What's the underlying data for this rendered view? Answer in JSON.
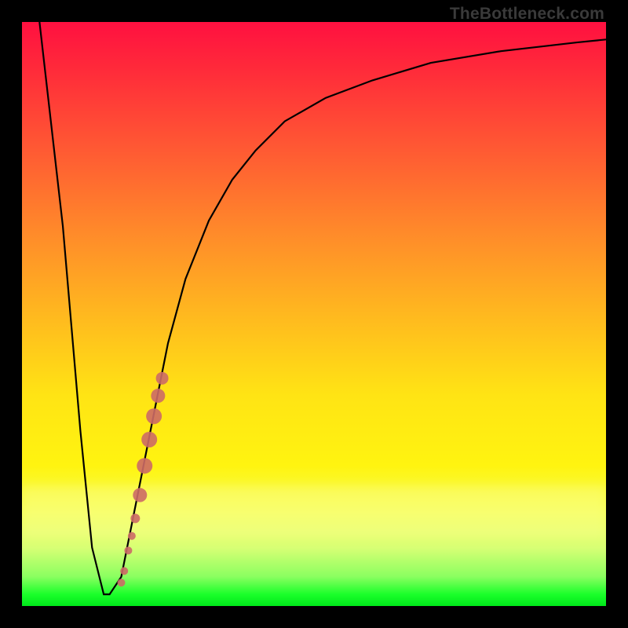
{
  "attribution": "TheBottleneck.com",
  "chart_data": {
    "type": "line",
    "title": "",
    "xlabel": "",
    "ylabel": "",
    "xlim": [
      0,
      100
    ],
    "ylim": [
      0,
      100
    ],
    "grid": false,
    "legend": false,
    "background_gradient": {
      "direction": "vertical",
      "stops": [
        {
          "pos": 0.0,
          "color": "#ff1040"
        },
        {
          "pos": 0.22,
          "color": "#ff5a33"
        },
        {
          "pos": 0.5,
          "color": "#ffb81f"
        },
        {
          "pos": 0.76,
          "color": "#fff410"
        },
        {
          "pos": 0.9,
          "color": "#d8ff75"
        },
        {
          "pos": 1.0,
          "color": "#00e81a"
        }
      ]
    },
    "series": [
      {
        "name": "bottleneck-curve",
        "color": "#000000",
        "x": [
          3,
          7,
          10,
          12,
          14,
          15,
          17,
          19,
          22,
          25,
          28,
          32,
          36,
          40,
          45,
          52,
          60,
          70,
          82,
          95,
          100
        ],
        "y": [
          100,
          65,
          30,
          10,
          2,
          2,
          5,
          15,
          30,
          45,
          56,
          66,
          73,
          78,
          83,
          87,
          90,
          93,
          95,
          96.5,
          97
        ]
      }
    ],
    "scatter": {
      "name": "highlight-points",
      "color": "#cc6a66",
      "points": [
        {
          "x": 17.0,
          "y": 4.0,
          "r": 5
        },
        {
          "x": 17.5,
          "y": 6.0,
          "r": 5
        },
        {
          "x": 18.2,
          "y": 9.5,
          "r": 5
        },
        {
          "x": 18.8,
          "y": 12.0,
          "r": 5
        },
        {
          "x": 19.4,
          "y": 15.0,
          "r": 6
        },
        {
          "x": 20.2,
          "y": 19.0,
          "r": 9
        },
        {
          "x": 21.0,
          "y": 24.0,
          "r": 10
        },
        {
          "x": 21.8,
          "y": 28.5,
          "r": 10
        },
        {
          "x": 22.6,
          "y": 32.5,
          "r": 10
        },
        {
          "x": 23.3,
          "y": 36.0,
          "r": 9
        },
        {
          "x": 24.0,
          "y": 39.0,
          "r": 8
        }
      ]
    }
  }
}
